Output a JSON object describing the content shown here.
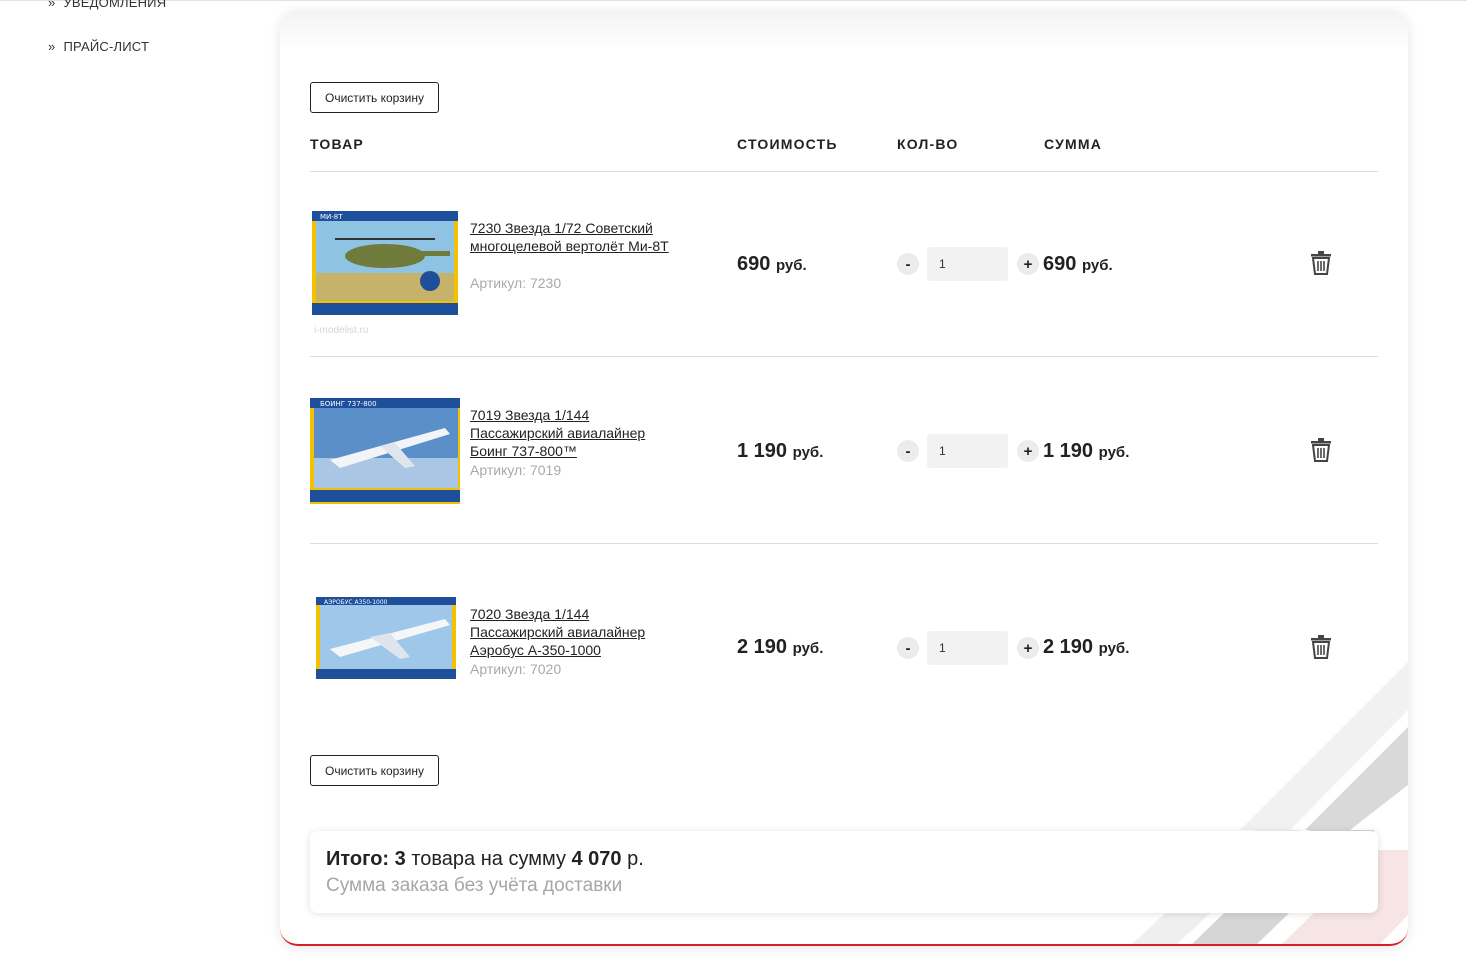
{
  "sidebar": {
    "items": [
      {
        "bullet": "»",
        "label": "УВЕДОМЛЕНИЯ"
      },
      {
        "bullet": "»",
        "label": "ПРАЙС-ЛИСТ"
      }
    ]
  },
  "cart": {
    "clear_label": "Очистить корзину",
    "columns": {
      "product": "ТОВАР",
      "price": "СТОИМОСТЬ",
      "qty": "КОЛ-ВО",
      "sum": "СУММА"
    },
    "items": [
      {
        "name": "7230 Звезда 1/72 Советский многоцелевой вертолёт Ми-8Т",
        "sku": "Артикул: 7230",
        "price": "690",
        "price_currency": "руб.",
        "qty": "1",
        "sum": "690",
        "sum_currency": "руб.",
        "minus": "-",
        "plus": "+",
        "watermark": "i-modelist.ru",
        "box_label": "МИ-8Т",
        "box_color": "#f2c200"
      },
      {
        "name": "7019 Звезда 1/144 Пассажирский авиалайнер Боинг 737-800™",
        "sku": "Артикул: 7019",
        "price": "1 190",
        "price_currency": "руб.",
        "qty": "1",
        "sum": "1 190",
        "sum_currency": "руб.",
        "minus": "-",
        "plus": "+",
        "watermark": "",
        "box_label": "БОИНГ 737-800",
        "box_color": "#f2c200"
      },
      {
        "name": "7020 Звезда 1/144 Пассажирский авиалайнер Аэробус А-350-1000",
        "sku": "Артикул: 7020",
        "price": "2 190",
        "price_currency": "руб.",
        "qty": "1",
        "sum": "2 190",
        "sum_currency": "руб.",
        "minus": "-",
        "plus": "+",
        "watermark": "",
        "box_label": "АЭРОБУС A350-1000",
        "box_color": "#f2c200"
      }
    ],
    "total": {
      "label": "Итого:",
      "count": "3",
      "text_mid": "товара на сумму",
      "amount": "4 070",
      "currency": "р.",
      "note": "Сумма заказа без учёта доставки"
    }
  },
  "colors": {
    "accent": "#d5202c",
    "muted_text": "#a6a6a6"
  }
}
